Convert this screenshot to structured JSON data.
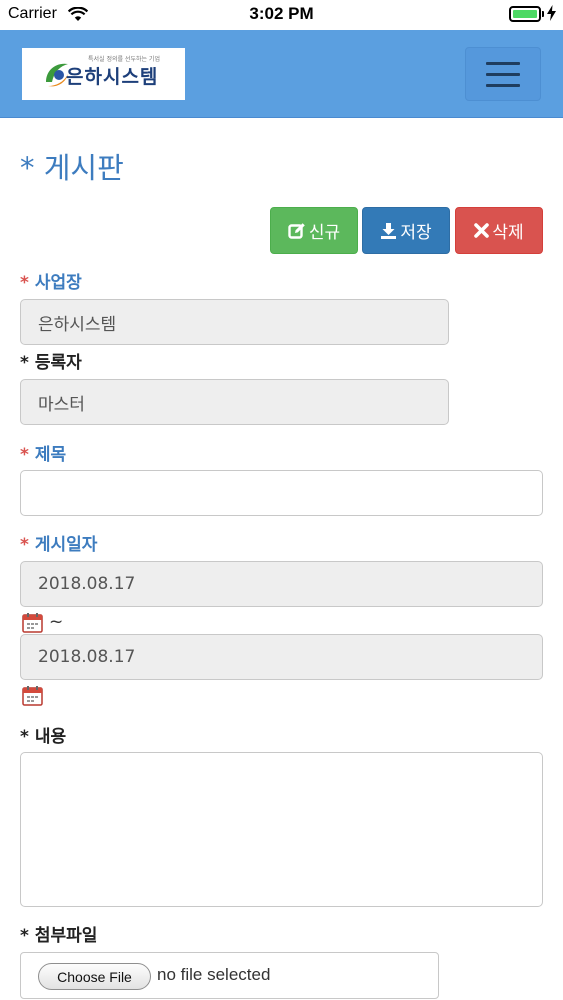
{
  "status_bar": {
    "carrier": "Carrier",
    "time": "3:02 PM",
    "battery_level": 1.0,
    "battery_color": "#4cd964",
    "icons": [
      "wifi-icon",
      "battery-icon",
      "charging-bolt-icon"
    ]
  },
  "header": {
    "logo_text": "은하시스템",
    "logo_slogan": "특서실 정의를 선두하는 기업",
    "menu_icon": "hamburger-menu-icon",
    "background_color": "#5b9fe0"
  },
  "page": {
    "title": "* 게시판"
  },
  "toolbar": {
    "new_label": "신규",
    "new_icon": "edit-icon",
    "save_label": "저장",
    "save_icon": "download-icon",
    "delete_label": "삭제",
    "delete_icon": "close-icon",
    "colors": {
      "new": "#5cb85c",
      "save": "#337ab7",
      "delete": "#d9534f"
    }
  },
  "form": {
    "workplace": {
      "star": "*",
      "label": "사업장",
      "value": "은하시스템"
    },
    "registrant": {
      "star": "*",
      "label": "등록자",
      "value": "마스터"
    },
    "subject": {
      "star": "*",
      "label": "제목",
      "value": ""
    },
    "post_date": {
      "star": "*",
      "label": "게시일자",
      "from": "2018.08.17",
      "separator": "~",
      "to": "2018.08.17",
      "icon": "calendar-icon"
    },
    "content": {
      "star": "*",
      "label": "내용",
      "value": ""
    },
    "attachment": {
      "star": "*",
      "label": "첨부파일",
      "button_label": "Choose File",
      "status": "no file selected"
    }
  }
}
